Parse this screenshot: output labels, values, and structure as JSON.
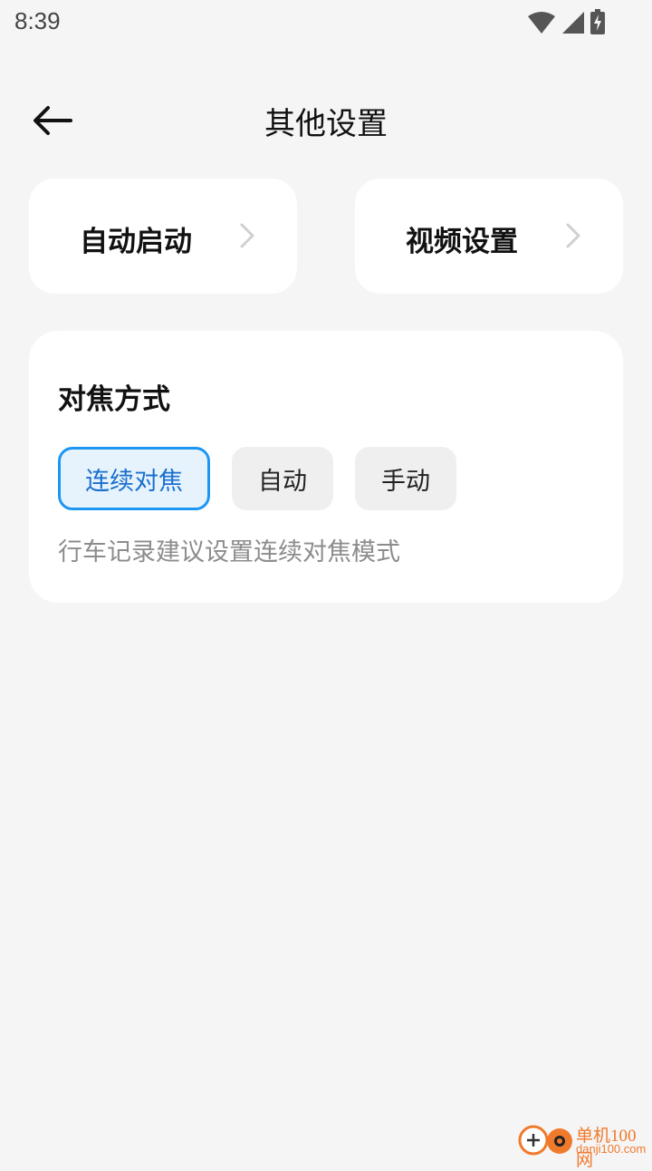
{
  "status_bar": {
    "time": "8:39"
  },
  "header": {
    "title": "其他设置",
    "back_icon": "arrow-left-icon"
  },
  "nav_cards": [
    {
      "label": "自动启动",
      "icon": "chevron-right-icon"
    },
    {
      "label": "视频设置",
      "icon": "chevron-right-icon"
    }
  ],
  "focus": {
    "title": "对焦方式",
    "options": [
      {
        "label": "连续对焦",
        "selected": true
      },
      {
        "label": "自动",
        "selected": false
      },
      {
        "label": "手动",
        "selected": false
      }
    ],
    "hint": "行车记录建议设置连续对焦模式"
  },
  "watermark": {
    "cn": "单机100网",
    "en": "danji100.com"
  },
  "colors": {
    "background": "#f5f5f5",
    "card": "#ffffff",
    "accent": "#1d96f2",
    "accent_text": "#1a6fcf",
    "selected_bg": "#e6f3fd",
    "option_bg": "#efefef",
    "hint_text": "#8c8c8c",
    "watermark": "#f07a2c"
  }
}
